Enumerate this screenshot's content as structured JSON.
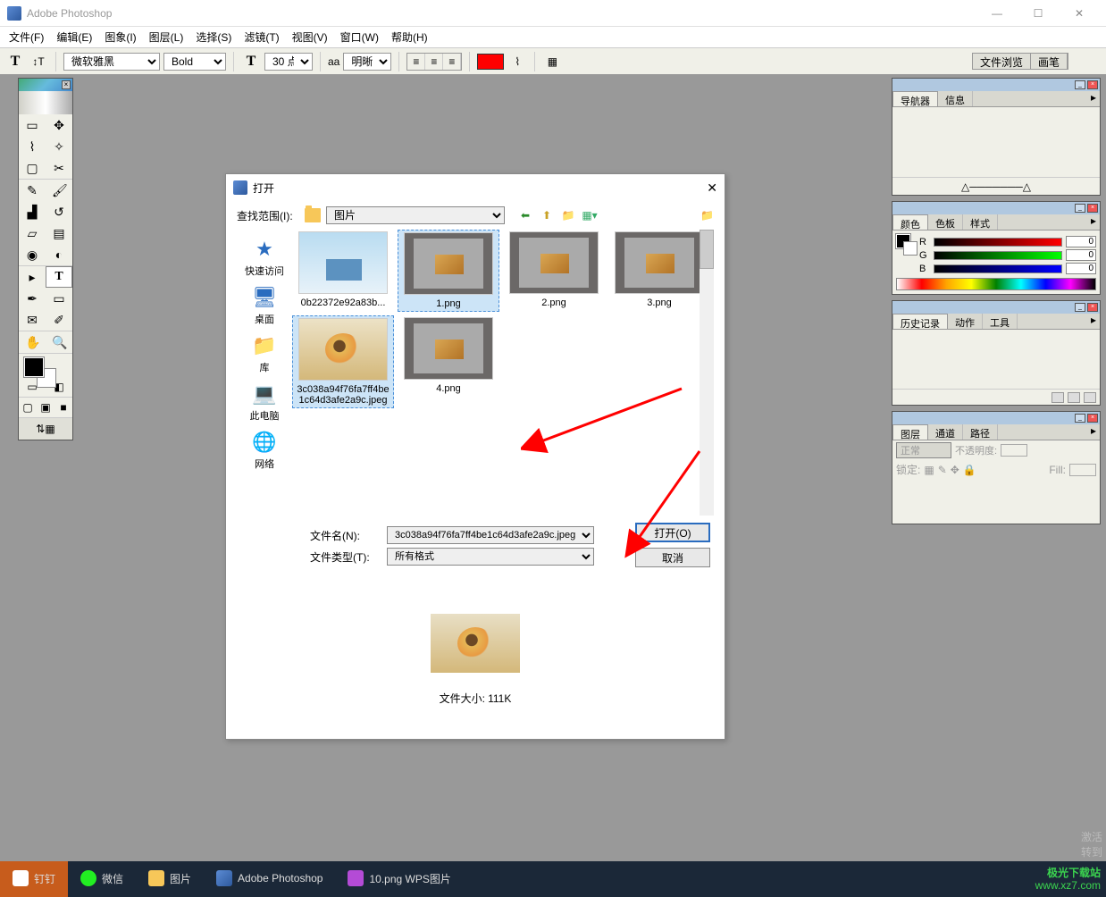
{
  "app": {
    "title": "Adobe Photoshop"
  },
  "window_buttons": {
    "min": "—",
    "max": "☐",
    "close": "✕"
  },
  "menu": {
    "file": "文件(F)",
    "edit": "编辑(E)",
    "image": "图象(I)",
    "layer": "图层(L)",
    "select": "选择(S)",
    "filter": "滤镜(T)",
    "view": "视图(V)",
    "window": "窗口(W)",
    "help": "帮助(H)"
  },
  "options": {
    "font": "微软雅黑",
    "weight": "Bold",
    "size": "30 点",
    "aa_label": "aa",
    "aa": "明晰",
    "color": "#ff0000",
    "file_browse": "文件浏览",
    "brush": "画笔"
  },
  "panels": {
    "navigator": {
      "tab1": "导航器",
      "tab2": "信息"
    },
    "color": {
      "tab1": "颜色",
      "tab2": "色板",
      "tab3": "样式",
      "r_label": "R",
      "g_label": "G",
      "b_label": "B",
      "r": "0",
      "g": "0",
      "b": "0"
    },
    "history": {
      "tab1": "历史记录",
      "tab2": "动作",
      "tab3": "工具"
    },
    "layers": {
      "tab1": "图层",
      "tab2": "通道",
      "tab3": "路径",
      "blend": "正常",
      "opacity_label": "不透明度:",
      "lock_label": "锁定:",
      "fill_label": "Fill:"
    }
  },
  "dialog": {
    "title": "打开",
    "lookin_label": "查找范围(I):",
    "lookin": "图片",
    "side": {
      "quick": "快速访问",
      "desktop": "桌面",
      "libs": "库",
      "pc": "此电脑",
      "net": "网络"
    },
    "files": [
      {
        "name": "0b22372e92a83b...",
        "thumb": "sky"
      },
      {
        "name": "1.png",
        "thumb": "ps"
      },
      {
        "name": "2.png",
        "thumb": "ps"
      },
      {
        "name": "3.png",
        "thumb": "ps"
      },
      {
        "name": "3c038a94f76fa7ff4be1c64d3afe2a9c.jpeg",
        "thumb": "flower"
      },
      {
        "name": "4.png",
        "thumb": "ps"
      }
    ],
    "filename_label": "文件名(N):",
    "filename": "3c038a94f76fa7ff4be1c64d3afe2a9c.jpeg",
    "filetype_label": "文件类型(T):",
    "filetype": "所有格式",
    "open_btn": "打开(O)",
    "cancel_btn": "取消",
    "filesize_label": "文件大小:",
    "filesize": "111K"
  },
  "watermark": {
    "line1": "激活",
    "line2": "转到"
  },
  "taskbar": {
    "t1": "钉钉",
    "t2": "微信",
    "t3": "图片",
    "t4": "Adobe Photoshop",
    "t5": "10.png  WPS图片"
  },
  "site": {
    "name": "极光下载站",
    "url": "www.xz7.com"
  }
}
